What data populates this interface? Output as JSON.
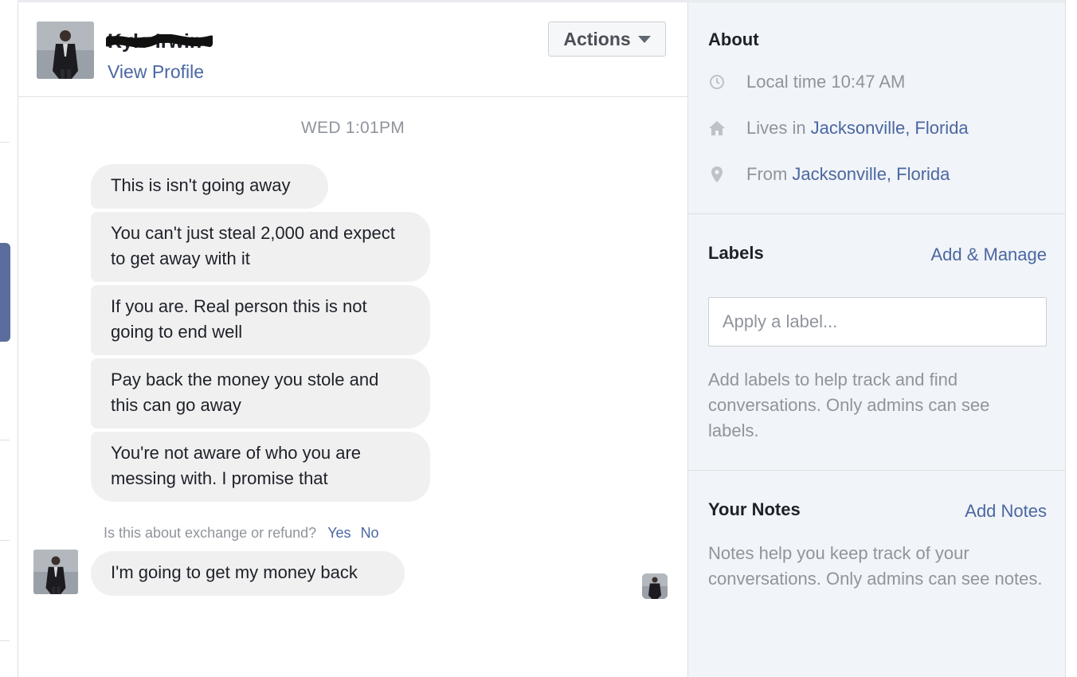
{
  "header": {
    "contact_name": "Kyle Irwin",
    "view_profile": "View Profile",
    "actions_label": "Actions"
  },
  "conversation": {
    "timestamp": "WED 1:01PM",
    "messages": [
      "This is isn't going away",
      "You can't just steal 2,000 and expect to get away with it",
      "If you are. Real person this is not going to end well",
      "Pay back the money you stole and this can go away",
      "You're not aware of who you are messing with. I promise that"
    ],
    "quick_question": "Is this about exchange or refund?",
    "quick_replies": [
      "Yes",
      "No"
    ],
    "last_message": "I'm going to get my money back"
  },
  "sidebar": {
    "about": {
      "title": "About",
      "local_time": "Local time 10:47 AM",
      "lives_prefix": "Lives in",
      "lives_link": "Jacksonville, Florida",
      "from_prefix": "From",
      "from_link": "Jacksonville, Florida"
    },
    "labels": {
      "title": "Labels",
      "manage_link": "Add & Manage",
      "input_placeholder": "Apply a label...",
      "help": "Add labels to help track and find conversations. Only admins can see labels."
    },
    "notes": {
      "title": "Your Notes",
      "add_link": "Add Notes",
      "help": "Notes help you keep track of your conversations. Only admins can see notes."
    }
  },
  "colors": {
    "link": "#4b67a1",
    "bubble": "#f1f0f0",
    "muted_text": "#90949c",
    "sidebar_bg": "#f1f4f8"
  },
  "icons": [
    "clock-icon",
    "home-icon",
    "location-pin-icon",
    "caret-down-icon"
  ]
}
